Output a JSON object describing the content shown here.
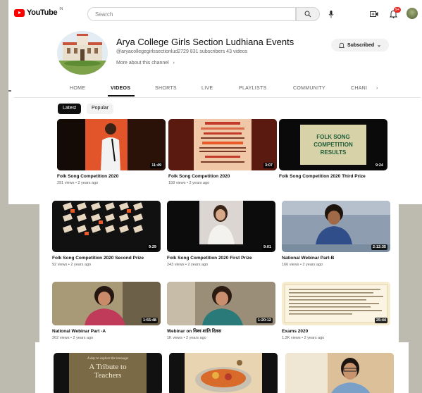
{
  "topbar": {
    "logo_text": "YouTube",
    "logo_sup": "IN",
    "search_placeholder": "Search",
    "notification_count": "9+"
  },
  "channel": {
    "name": "Arya College Girls Section Ludhiana Events",
    "handle": "@aryacollegegirlssectionlud2729",
    "subscribers": "831 subscribers",
    "videos": "43 videos",
    "more": "More about this channel",
    "subscribe_label": "Subscribed"
  },
  "tabs": [
    "HOME",
    "VIDEOS",
    "SHORTS",
    "LIVE",
    "PLAYLISTS",
    "COMMUNITY",
    "CHANI"
  ],
  "chips": [
    "Latest",
    "Popular"
  ],
  "videos": [
    {
      "title": "Folk Song Competition 2020",
      "meta": "291 views • 2 years ago",
      "duration": "11:49"
    },
    {
      "title": "Folk Song Competition 2020",
      "meta": "158 views • 2 years ago",
      "duration": "3:07"
    },
    {
      "title": "Folk Song Competition 2020 Third Prize",
      "meta": "",
      "duration": "9:24"
    },
    {
      "title": "Folk Song Competition 2020 Second Prize",
      "meta": "92 views • 2 years ago",
      "duration": "9:29"
    },
    {
      "title": "Folk Song Competition 2020 First Prize",
      "meta": "243 views • 2 years ago",
      "duration": "9:01"
    },
    {
      "title": "National Webinar Part-B",
      "meta": "166 views • 2 years ago",
      "duration": "2:12:35"
    },
    {
      "title": "National Webinar Part -A",
      "meta": "262 views • 2 years ago",
      "duration": "1:55:48"
    },
    {
      "title": "Webinar on विश्व शांति दिवस",
      "meta": "1K views • 2 years ago",
      "duration": "1:20:12"
    },
    {
      "title": "Exams 2020",
      "meta": "1.2K views • 2 years ago",
      "duration": "25:44"
    }
  ],
  "thumb_text": {
    "folk_results": "FOLK SONG COMPETITION RESULTS",
    "teachers_small": "A day to explore the message",
    "teachers_big": "A Tribute to Teachers"
  },
  "colors": {
    "brand": "#ff0000",
    "results_bg": "#d8d2a8",
    "results_text": "#1f5e3a",
    "poster_bg": "#f0c8a8",
    "teachers_bg": "#7b6a46"
  }
}
